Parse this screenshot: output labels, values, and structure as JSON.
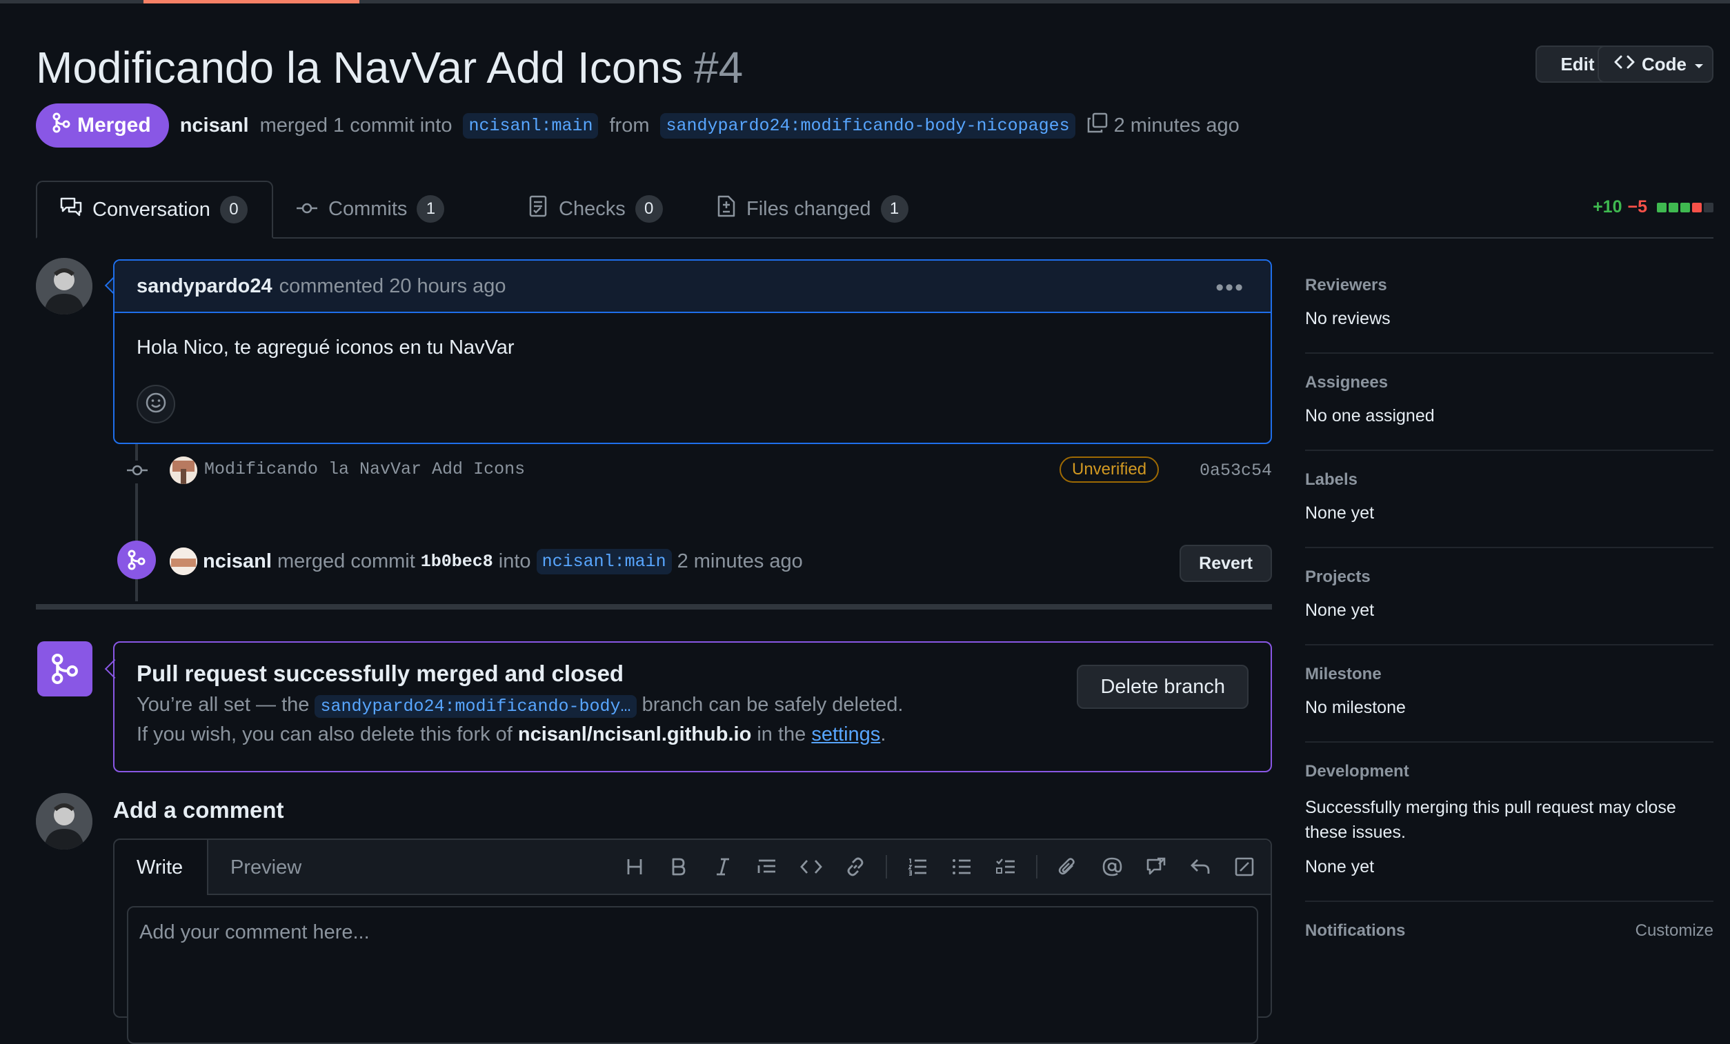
{
  "pr": {
    "title": "Modificando la NavVar Add Icons",
    "number": "#4",
    "status": "Merged",
    "author": "ncisanl",
    "action_text": "merged 1 commit into",
    "base_branch": "ncisanl:main",
    "from_text": "from",
    "head_branch": "sandypardo24:modificando-body-nicopages",
    "time": "2 minutes ago"
  },
  "header_buttons": {
    "edit": "Edit",
    "code": "Code"
  },
  "tabs": [
    {
      "label": "Conversation",
      "count": "0"
    },
    {
      "label": "Commits",
      "count": "1"
    },
    {
      "label": "Checks",
      "count": "0"
    },
    {
      "label": "Files changed",
      "count": "1"
    }
  ],
  "diffstat": {
    "additions": "+10",
    "deletions": "−5"
  },
  "comment": {
    "author": "sandypardo24",
    "meta": "commented 20 hours ago",
    "body": "Hola Nico, te agregué iconos en tu NavVar"
  },
  "commit": {
    "message": "Modificando la NavVar Add Icons",
    "badge": "Unverified",
    "sha": "0a53c54"
  },
  "merge_event": {
    "user": "ncisanl",
    "text": "merged commit",
    "sha": "1b0bec8",
    "into": "into",
    "branch": "ncisanl:main",
    "time": "2 minutes ago",
    "revert_label": "Revert"
  },
  "status_box": {
    "title": "Pull request successfully merged and closed",
    "line1_pre": "You’re all set — the",
    "branch": "sandypardo24:modificando-body…",
    "line1_post": "branch can be safely deleted.",
    "line2_pre": "If you wish, you can also delete this fork of",
    "repo": "ncisanl/ncisanl.github.io",
    "line2_mid": "in the",
    "settings_link": "settings",
    "line2_end": ".",
    "delete_label": "Delete branch"
  },
  "add_comment": {
    "title": "Add a comment",
    "write_tab": "Write",
    "preview_tab": "Preview",
    "placeholder": "Add your comment here..."
  },
  "sidebar": {
    "reviewers": {
      "label": "Reviewers",
      "value": "No reviews"
    },
    "assignees": {
      "label": "Assignees",
      "value": "No one assigned"
    },
    "labels": {
      "label": "Labels",
      "value": "None yet"
    },
    "projects": {
      "label": "Projects",
      "value": "None yet"
    },
    "milestone": {
      "label": "Milestone",
      "value": "No milestone"
    },
    "development": {
      "label": "Development",
      "desc": "Successfully merging this pull request may close these issues.",
      "value": "None yet"
    },
    "notifications": {
      "label": "Notifications",
      "customize": "Customize"
    }
  },
  "colors": {
    "merged_purple": "#8957e5",
    "link_blue": "#58a6ff",
    "addition_green": "#3fb950",
    "deletion_red": "#f85149",
    "background": "#0d1117"
  }
}
